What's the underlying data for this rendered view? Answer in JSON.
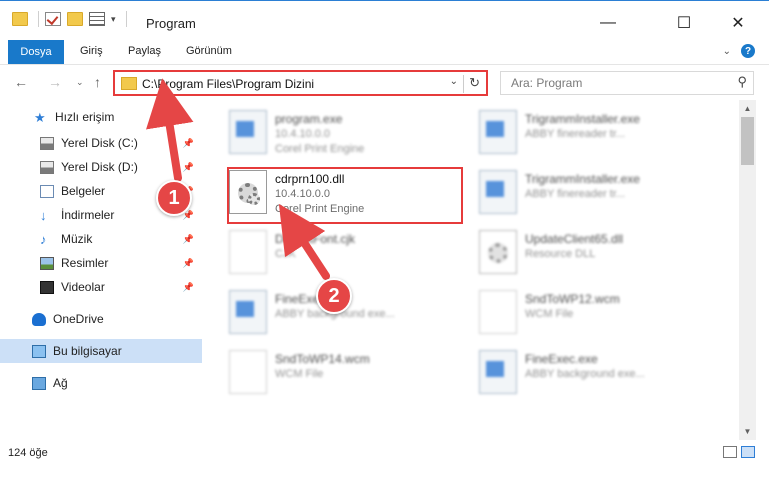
{
  "window": {
    "title": "Program",
    "minimize_icon": "minimize-icon",
    "maximize_icon": "maximize-icon",
    "close_icon": "close-icon"
  },
  "ribbon": {
    "file_tab": "Dosya",
    "tabs": [
      "Giriş",
      "Paylaş",
      "Görünüm"
    ]
  },
  "address": {
    "path": "C:\\Program Files\\Program Dizini"
  },
  "search": {
    "placeholder": "Ara: Program"
  },
  "sidebar": {
    "items": [
      {
        "label": "Hızlı erişim",
        "icon": "star-icon"
      },
      {
        "label": "Yerel Disk (C:)",
        "icon": "disk-icon",
        "pinned": true
      },
      {
        "label": "Yerel Disk (D:)",
        "icon": "disk-icon",
        "pinned": true
      },
      {
        "label": "Belgeler",
        "icon": "documents-icon",
        "pinned": true
      },
      {
        "label": "İndirmeler",
        "icon": "download-icon",
        "pinned": true
      },
      {
        "label": "Müzik",
        "icon": "music-icon",
        "pinned": true
      },
      {
        "label": "Resimler",
        "icon": "pictures-icon",
        "pinned": true
      },
      {
        "label": "Videolar",
        "icon": "videos-icon",
        "pinned": true
      },
      {
        "label": "OneDrive",
        "icon": "onedrive-icon"
      },
      {
        "label": "Bu bilgisayar",
        "icon": "computer-icon",
        "selected": true
      },
      {
        "label": "Ağ",
        "icon": "network-icon"
      }
    ]
  },
  "files": [
    {
      "name": "program.exe",
      "line2": "10.4.10.0.0",
      "line3": "Corel Print Engine"
    },
    {
      "name": "TrigrammInstaller.exe",
      "line2": "ABBY finereader tr...",
      "line3": ""
    },
    {
      "name": "cdrprn100.dll",
      "line2": "10.4.10.0.0",
      "line3": "Corel Print Engine"
    },
    {
      "name": "TrigrammInstaller.exe",
      "line2": "ABBY finereader tr...",
      "line3": ""
    },
    {
      "name": "DefaultFont.cjk",
      "line2": "CJK",
      "line3": ""
    },
    {
      "name": "UpdateClient65.dll",
      "line2": "Resource DLL",
      "line3": ""
    },
    {
      "name": "FineExec.exe",
      "line2": "ABBY background exe...",
      "line3": ""
    },
    {
      "name": "SndToWP12.wcm",
      "line2": "WCM File",
      "line3": ""
    },
    {
      "name": "SndToWP14.wcm",
      "line2": "WCM File",
      "line3": ""
    },
    {
      "name": "FineExec.exe",
      "line2": "ABBY background exe...",
      "line3": ""
    }
  ],
  "status": {
    "count": "124 öğe"
  },
  "annotations": {
    "step1": "1",
    "step2": "2",
    "color": "#e54646"
  }
}
